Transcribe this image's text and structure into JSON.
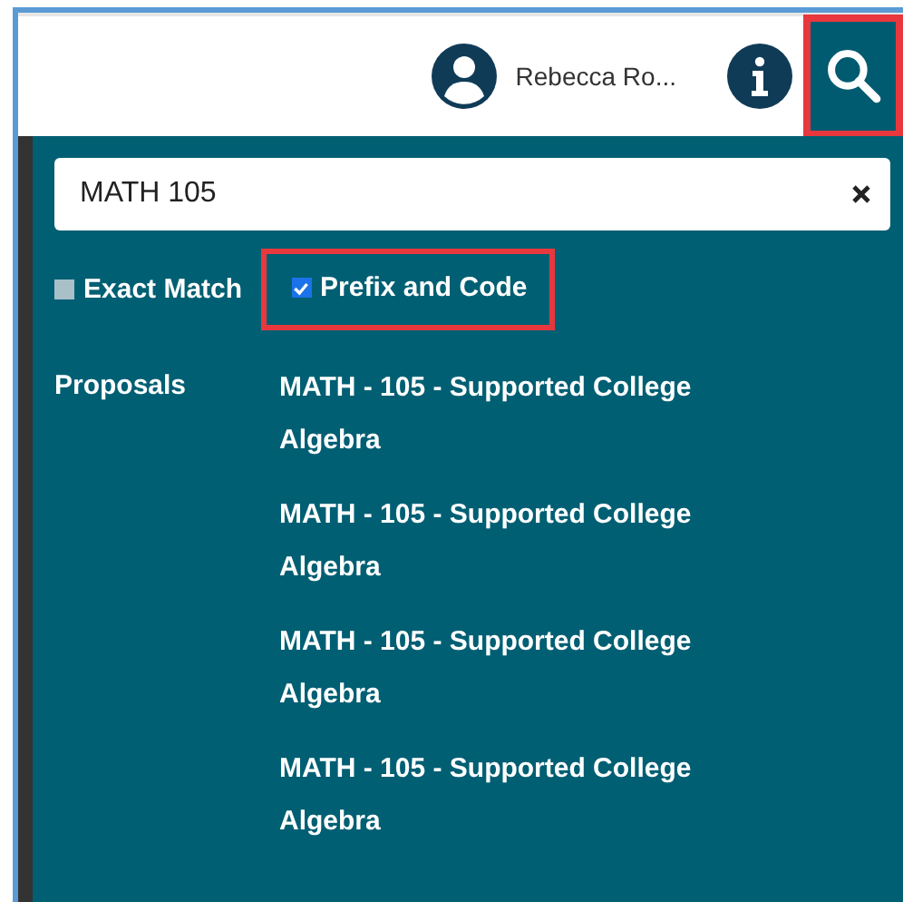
{
  "header": {
    "user_name": "Rebecca Ro...",
    "search_highlighted": true
  },
  "search": {
    "value": "MATH 105"
  },
  "options": [
    {
      "label": "Exact Match",
      "checked": false,
      "highlighted": false
    },
    {
      "label": "Prefix and Code",
      "checked": true,
      "highlighted": true
    }
  ],
  "results": {
    "group": "Proposals",
    "items": [
      "MATH - 105 - Supported College Algebra",
      "MATH - 105 - Supported College Algebra",
      "MATH - 105 - Supported College Algebra",
      "MATH - 105 - Supported College Algebra"
    ]
  }
}
